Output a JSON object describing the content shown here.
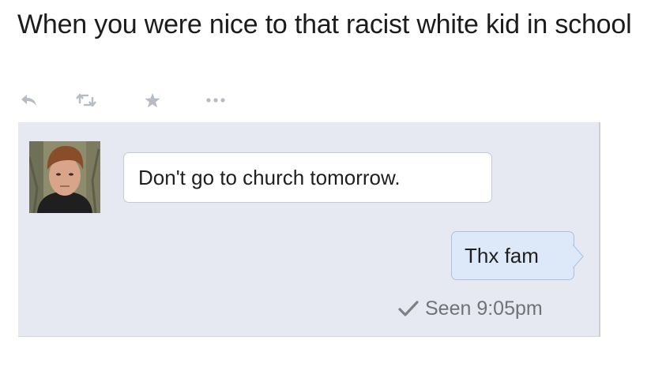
{
  "tweet": {
    "text": "When you were nice to that racist white kid in school"
  },
  "actions": {
    "icons": [
      "reply-icon",
      "retweet-icon",
      "favorite-icon",
      "more-icon"
    ],
    "color": "#b7bcc3"
  },
  "chat": {
    "incoming_message": "Don't go to church tomorrow.",
    "outgoing_message": "Thx fam",
    "seen_status": "Seen 9:05pm",
    "panel_color": "#e6e9f1",
    "incoming_bubble_color": "#ffffff",
    "outgoing_bubble_color": "#dde9f8"
  }
}
